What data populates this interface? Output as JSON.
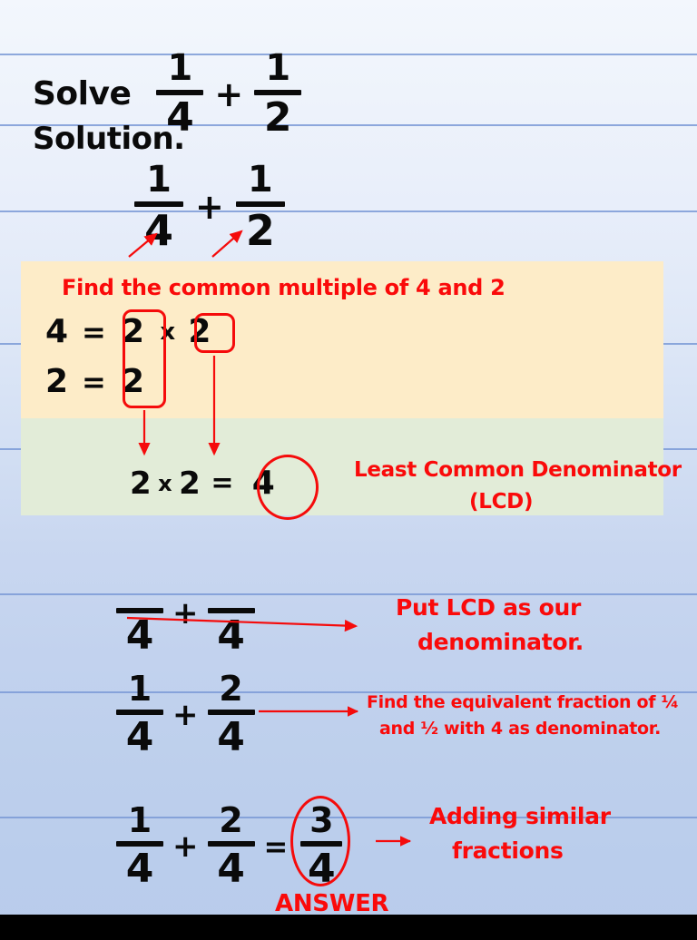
{
  "slide": {
    "title_line": {
      "label": "Solve",
      "fraction_a": {
        "numerator": "1",
        "denominator": "4"
      },
      "operator": "+",
      "fraction_b": {
        "numerator": "1",
        "denominator": "2"
      }
    },
    "solution_label": "Solution.",
    "restated_expression": {
      "fraction_a": {
        "numerator": "1",
        "denominator": "4"
      },
      "operator": "+",
      "fraction_b": {
        "numerator": "1",
        "denominator": "2"
      }
    },
    "yellow_box": {
      "heading": "Find the common multiple of 4 and 2",
      "rows": [
        {
          "value": "4",
          "equals": "=",
          "factor_one": "2",
          "times": "x",
          "factor_two": "2"
        },
        {
          "value": "2",
          "equals": "=",
          "factor_one": "2"
        }
      ]
    },
    "green_box": {
      "left_factor": "2",
      "times": "x",
      "right_factor": "2",
      "equals": "=",
      "result": "4",
      "annotation_line1": "Least Common Denominator",
      "annotation_line2": "(LCD)"
    },
    "step_lcd": {
      "fraction_a": {
        "numerator": "",
        "denominator": "4"
      },
      "operator": "+",
      "fraction_b": {
        "numerator": "",
        "denominator": "4"
      },
      "annotation_line1": "Put LCD as our",
      "annotation_line2": "denominator."
    },
    "step_equivalent": {
      "fraction_a": {
        "numerator": "1",
        "denominator": "4"
      },
      "operator": "+",
      "fraction_b": {
        "numerator": "2",
        "denominator": "4"
      },
      "annotation_line1": "Find the equivalent fraction of ¼",
      "annotation_line2": "and ½ with 4 as denominator."
    },
    "step_answer": {
      "fraction_a": {
        "numerator": "1",
        "denominator": "4"
      },
      "operator": "+",
      "fraction_b": {
        "numerator": "2",
        "denominator": "4"
      },
      "equals": "=",
      "result": {
        "numerator": "3",
        "denominator": "4"
      },
      "answer_label": "ANSWER",
      "annotation_line1": "Adding similar",
      "annotation_line2": "fractions"
    },
    "colors": {
      "red_ink": "#fa0a0a",
      "black_ink": "#0a0a0a",
      "rule_line": "#7b9ad6",
      "yellow_block": "#fdecc8",
      "green_block": "#e2ecd8",
      "bottom_bar": "#000000"
    }
  }
}
